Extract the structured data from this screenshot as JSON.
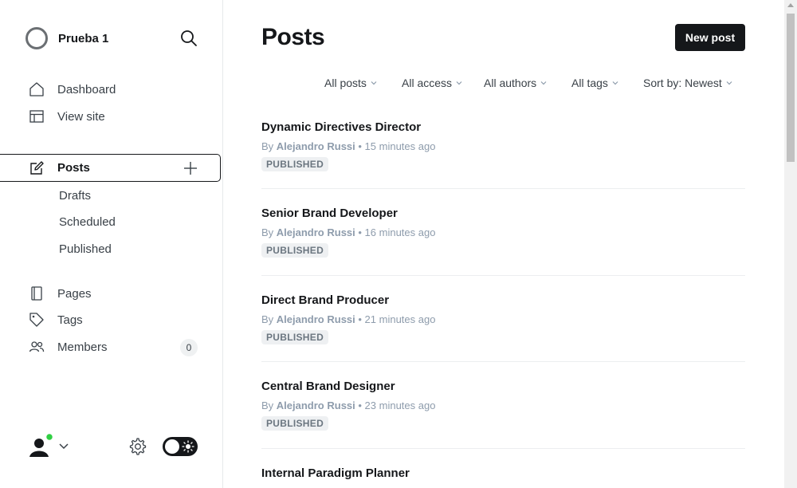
{
  "sidebar": {
    "site_name": "Prueba 1",
    "nav_top": [
      {
        "label": "Dashboard",
        "icon": "home-icon"
      },
      {
        "label": "View site",
        "icon": "layout-icon"
      }
    ],
    "posts": {
      "label": "Posts",
      "icon": "edit-icon"
    },
    "post_subitems": [
      "Drafts",
      "Scheduled",
      "Published"
    ],
    "nav_bottom": [
      {
        "label": "Pages",
        "icon": "page-icon"
      },
      {
        "label": "Tags",
        "icon": "tag-icon"
      },
      {
        "label": "Members",
        "icon": "members-icon",
        "count": "0"
      }
    ]
  },
  "main": {
    "title": "Posts",
    "new_post_label": "New post",
    "filters": [
      "All posts",
      "All access",
      "All authors",
      "All tags",
      "Sort by: Newest"
    ],
    "posts": [
      {
        "title": "Dynamic Directives Director",
        "by": "By",
        "author": "Alejandro Russi",
        "time": "• 15 minutes ago",
        "status": "PUBLISHED"
      },
      {
        "title": "Senior Brand Developer",
        "by": "By",
        "author": "Alejandro Russi",
        "time": "• 16 minutes ago",
        "status": "PUBLISHED"
      },
      {
        "title": "Direct Brand Producer",
        "by": "By",
        "author": "Alejandro Russi",
        "time": "• 21 minutes ago",
        "status": "PUBLISHED"
      },
      {
        "title": "Central Brand Designer",
        "by": "By",
        "author": "Alejandro Russi",
        "time": "• 23 minutes ago",
        "status": "PUBLISHED"
      },
      {
        "title": "Internal Paradigm Planner"
      }
    ]
  },
  "colors": {
    "accent": "#15171a",
    "online": "#30cf43",
    "muted": "#8e9cac"
  }
}
